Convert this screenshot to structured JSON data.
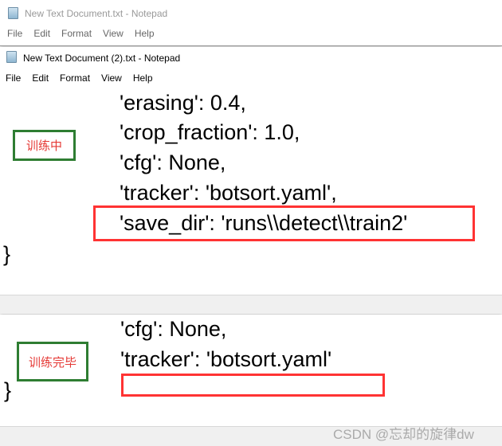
{
  "window_back": {
    "title": "New Text Document.txt - Notepad",
    "menu": [
      "File",
      "Edit",
      "Format",
      "View",
      "Help"
    ]
  },
  "window_front": {
    "title": "New Text Document (2).txt - Notepad",
    "menu": [
      "File",
      "Edit",
      "Format",
      "View",
      "Help"
    ]
  },
  "panel_training": {
    "label": "训练中",
    "lines": [
      "'erasing': 0.4,",
      "'crop_fraction': 1.0,",
      "'cfg': None,",
      "'tracker': 'botsort.yaml',",
      "'save_dir': 'runs\\\\detect\\\\train2'"
    ],
    "brace": "}"
  },
  "panel_done": {
    "label": "训练完毕",
    "lines": [
      "'cfg': None,",
      "'tracker': 'botsort.yaml'"
    ],
    "brace": "}"
  },
  "watermark": "CSDN @忘却的旋律dw",
  "colors": {
    "highlight_box": "#ff3333",
    "label_box": "#2e7d32",
    "label_text": "#e53935"
  }
}
